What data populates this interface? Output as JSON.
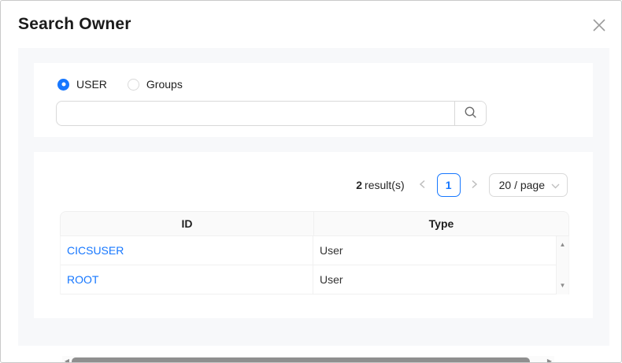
{
  "dialog": {
    "title": "Search Owner"
  },
  "search_panel": {
    "radios": [
      {
        "label": "USER",
        "selected": true
      },
      {
        "label": "Groups",
        "selected": false
      }
    ],
    "search_input": {
      "value": "",
      "placeholder": ""
    }
  },
  "results_panel": {
    "result_count": "2",
    "result_label": "result(s)",
    "pagination": {
      "current_page": "1",
      "page_size": "20 / page"
    },
    "table": {
      "headers": {
        "id": "ID",
        "type": "Type"
      },
      "rows": [
        {
          "id": "CICSUSER",
          "type": "User"
        },
        {
          "id": "ROOT",
          "type": "User"
        }
      ]
    }
  },
  "icons": {
    "scroll_up": "▲",
    "scroll_down": "▼",
    "scroll_left": "◀",
    "scroll_right": "▶"
  },
  "colors": {
    "accent_blue": "#1677ff",
    "link_blue": "#1677ff",
    "content_bg": "#f7f8fa",
    "table_header_bg": "#fafafa",
    "border_light": "#f0f0f0",
    "border_input": "#d9d9d9",
    "scroll_thumb": "#8f8f8f"
  }
}
